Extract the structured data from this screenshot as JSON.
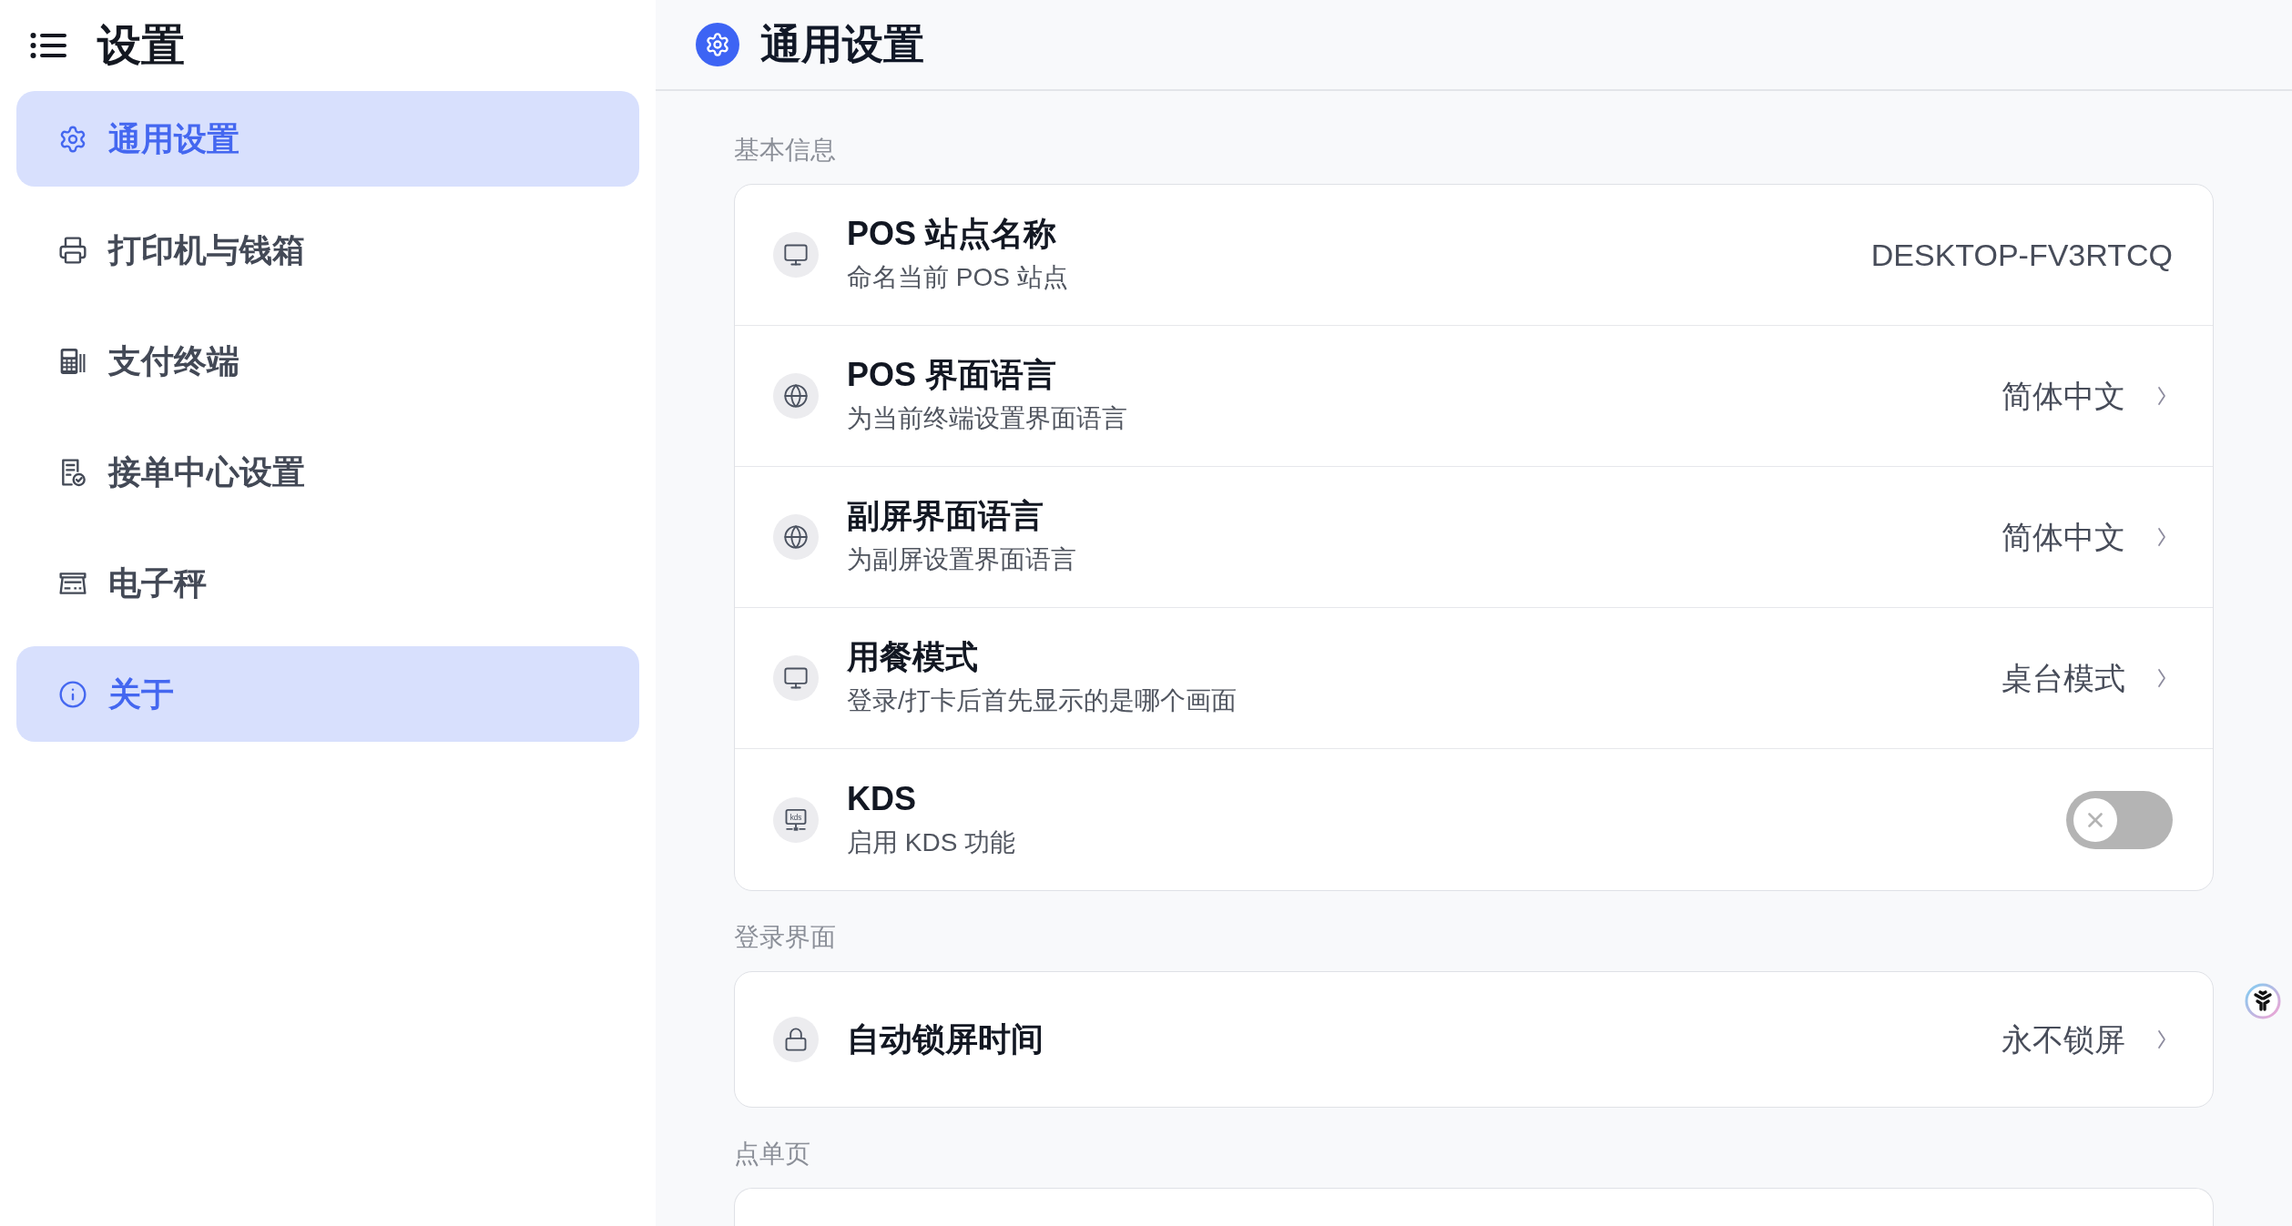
{
  "sidebar": {
    "title": "设置",
    "items": [
      {
        "label": "通用设置",
        "selected": true
      },
      {
        "label": "打印机与钱箱",
        "selected": false
      },
      {
        "label": "支付终端",
        "selected": false
      },
      {
        "label": "接单中心设置",
        "selected": false
      },
      {
        "label": "电子秤",
        "selected": false
      },
      {
        "label": "关于",
        "selected": true
      }
    ]
  },
  "header": {
    "title": "通用设置"
  },
  "sections": [
    {
      "title": "基本信息",
      "rows": [
        {
          "kind": "text",
          "title": "POS 站点名称",
          "description": "命名当前 POS 站点",
          "value": "DESKTOP-FV3RTCQ"
        },
        {
          "kind": "select",
          "title": "POS 界面语言",
          "description": "为当前终端设置界面语言",
          "value": "简体中文"
        },
        {
          "kind": "select",
          "title": "副屏界面语言",
          "description": "为副屏设置界面语言",
          "value": "简体中文"
        },
        {
          "kind": "select",
          "title": "用餐模式",
          "description": "登录/打卡后首先显示的是哪个画面",
          "value": "桌台模式"
        },
        {
          "kind": "toggle",
          "title": "KDS",
          "description": "启用 KDS 功能",
          "icon_text": "kds",
          "on": false
        }
      ]
    },
    {
      "title": "登录界面",
      "rows": [
        {
          "kind": "select",
          "title": "自动锁屏时间",
          "value": "永不锁屏"
        }
      ]
    },
    {
      "title": "点单页"
    }
  ]
}
